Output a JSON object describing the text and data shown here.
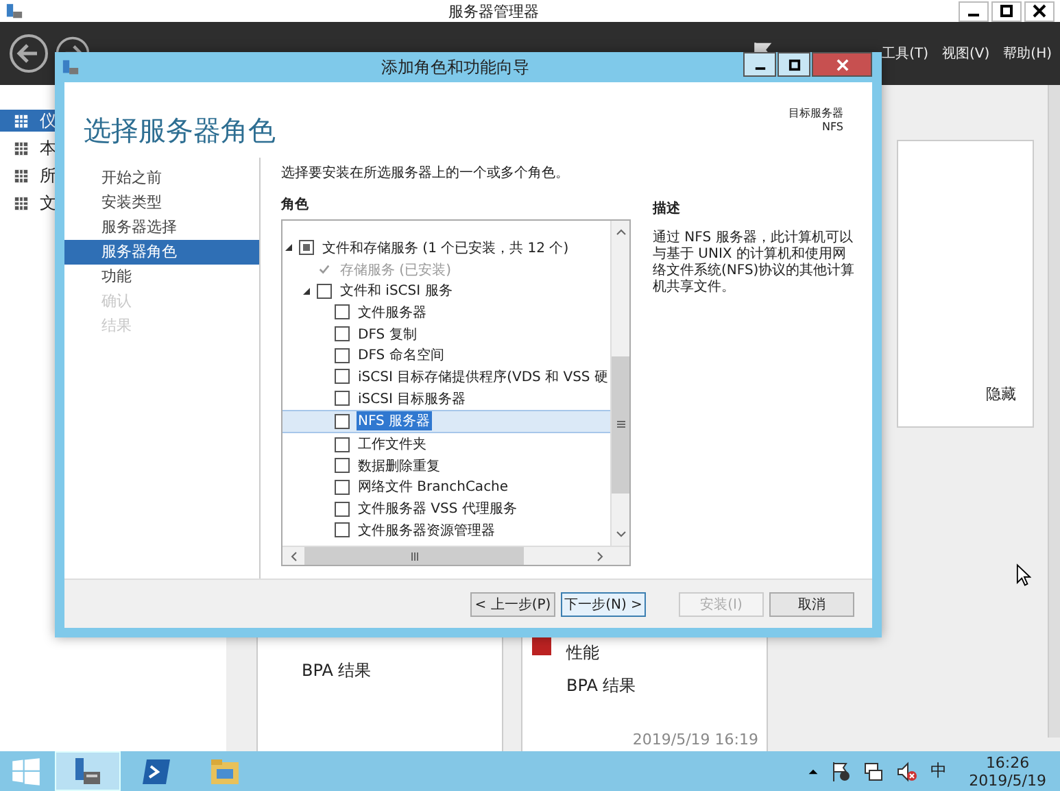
{
  "window": {
    "title": "服务器管理器"
  },
  "menu": [
    {
      "label": "工具(T)"
    },
    {
      "label": "视图(V)"
    },
    {
      "label": "帮助(H)"
    }
  ],
  "sidebar": {
    "items": [
      {
        "label": "仪",
        "selected": true
      },
      {
        "label": "本",
        "selected": false
      },
      {
        "label": "所",
        "selected": false
      },
      {
        "label": "文",
        "selected": false
      }
    ]
  },
  "hide_panel": {
    "label": "隐藏"
  },
  "tiles": [
    {
      "items": [
        "BPA 结果"
      ]
    },
    {
      "items": [
        "性能",
        "BPA 结果"
      ],
      "timestamp": "2019/5/19 16:19"
    }
  ],
  "dialog": {
    "title": "添加角色和功能向导",
    "heading": "选择服务器角色",
    "target_label": "目标服务器",
    "target_value": "NFS",
    "steps": [
      {
        "label": "开始之前",
        "selected": false,
        "disabled": false
      },
      {
        "label": "安装类型",
        "selected": false,
        "disabled": false
      },
      {
        "label": "服务器选择",
        "selected": false,
        "disabled": false
      },
      {
        "label": "服务器角色",
        "selected": true,
        "disabled": false
      },
      {
        "label": "功能",
        "selected": false,
        "disabled": false
      },
      {
        "label": "确认",
        "selected": false,
        "disabled": true
      },
      {
        "label": "结果",
        "selected": false,
        "disabled": true
      }
    ],
    "instruction": "选择要安装在所选服务器上的一个或多个角色。",
    "roles_heading": "角色",
    "roles": [
      {
        "label": "文件和存储服务 (1 个已安装，共 12 个)",
        "expanded": true,
        "indeterminate": true,
        "disabled": false,
        "selected": false,
        "children": [
          {
            "label": "存储服务 (已安装)",
            "checked": true,
            "disabled": true,
            "selected": false
          },
          {
            "label": "文件和 iSCSI 服务",
            "expanded": true,
            "checked": false,
            "disabled": false,
            "selected": false,
            "children": [
              {
                "label": "文件服务器",
                "checked": false,
                "disabled": false,
                "selected": false
              },
              {
                "label": "DFS 复制",
                "checked": false,
                "disabled": false,
                "selected": false
              },
              {
                "label": "DFS 命名空间",
                "checked": false,
                "disabled": false,
                "selected": false
              },
              {
                "label": "iSCSI 目标存储提供程序(VDS 和 VSS 硬",
                "checked": false,
                "disabled": false,
                "selected": false
              },
              {
                "label": "iSCSI 目标服务器",
                "checked": false,
                "disabled": false,
                "selected": false
              },
              {
                "label": "NFS 服务器",
                "checked": false,
                "disabled": false,
                "selected": true
              },
              {
                "label": "工作文件夹",
                "checked": false,
                "disabled": false,
                "selected": false
              },
              {
                "label": "数据删除重复",
                "checked": false,
                "disabled": false,
                "selected": false
              },
              {
                "label": "网络文件 BranchCache",
                "checked": false,
                "disabled": false,
                "selected": false
              },
              {
                "label": "文件服务器 VSS 代理服务",
                "checked": false,
                "disabled": false,
                "selected": false
              },
              {
                "label": "文件服务器资源管理器",
                "checked": false,
                "disabled": false,
                "selected": false
              }
            ]
          }
        ]
      }
    ],
    "description_heading": "描述",
    "description": "通过 NFS 服务器，此计算机可以与基于 UNIX 的计算机和使用网络文件系统(NFS)协议的其他计算机共享文件。",
    "buttons": [
      {
        "label": "< 上一步(P)",
        "disabled": false,
        "focused": false
      },
      {
        "label": "下一步(N) >",
        "disabled": false,
        "focused": true
      },
      {
        "label": "安装(I)",
        "disabled": true,
        "focused": false
      },
      {
        "label": "取消",
        "disabled": false,
        "focused": false
      }
    ]
  },
  "taskbar": {
    "items": [
      {
        "kind": "server",
        "selected": true
      },
      {
        "kind": "powershell",
        "selected": false
      },
      {
        "kind": "explorer",
        "selected": false
      }
    ],
    "ime": "中",
    "time": "16:26",
    "date": "2019/5/19"
  }
}
